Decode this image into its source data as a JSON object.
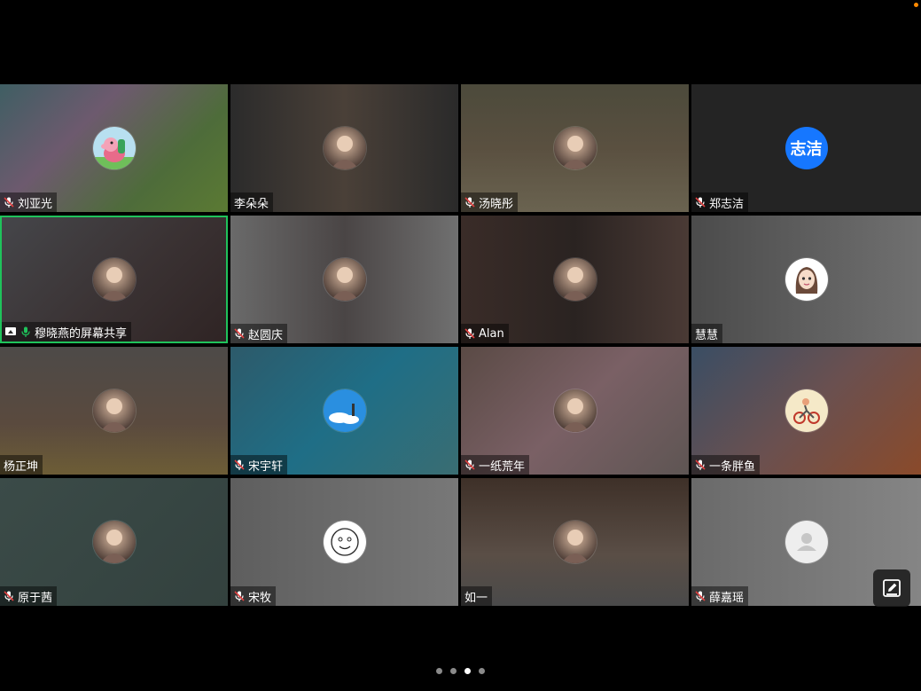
{
  "colors": {
    "active_border": "#1fc35b",
    "mic_on": "#1fc35b",
    "muted_icon": "#ffffff",
    "status_dot": "#ff8a00"
  },
  "participants": [
    {
      "name": "刘亚光",
      "mic": "muted",
      "avatar_icon": "peppa-pig-avatar",
      "bg": "linear-gradient(135deg,#3f5e63 0%,#6d5a6e 35%,#4e6c3a 70%,#5b7a33 100%)"
    },
    {
      "name": "李朵朵",
      "mic": "none",
      "avatar_icon": "photo-avatar",
      "bg": "linear-gradient(90deg,#2b2b2b 0%,#4a4038 50%,#2a2a2a 100%)"
    },
    {
      "name": "汤晓彤",
      "mic": "muted",
      "avatar_icon": "photo-avatar",
      "bg": "linear-gradient(180deg,#4c4a3b 0%,#5a5040 50%,#6a6350 100%)"
    },
    {
      "name": "郑志洁",
      "mic": "muted",
      "avatar_icon": "text-avatar",
      "avatar_text": "志洁",
      "bg": "#242424"
    },
    {
      "name": "穆晓燕的屏幕共享",
      "mic": "on",
      "screen_share": true,
      "active": true,
      "avatar_icon": "photo-avatar",
      "bg": "linear-gradient(135deg,#45464a 0%,#3a3233 55%,#2f2424 100%)"
    },
    {
      "name": "赵圆庆",
      "mic": "muted",
      "avatar_icon": "photo-avatar",
      "bg": "linear-gradient(90deg,#6a6a6a 0%,#4a4545 50%,#707070 100%)"
    },
    {
      "name": "Alan",
      "mic": "muted",
      "avatar_icon": "photo-avatar",
      "bg": "linear-gradient(90deg,#3a2c28 0%,#2a2321 50%,#4a3a35 100%)"
    },
    {
      "name": "慧慧",
      "mic": "none",
      "avatar_icon": "cartoon-girl-avatar",
      "bg": "linear-gradient(90deg,#4b4b4b 0%,#707070 100%)"
    },
    {
      "name": "杨正坤",
      "mic": "none",
      "avatar_icon": "photo-avatar",
      "bg": "linear-gradient(180deg,#4d4a48 0%,#5a4a3e 60%,#6d5d36 100%)"
    },
    {
      "name": "宋宇轩",
      "mic": "muted",
      "avatar_icon": "sky-avatar",
      "bg": "linear-gradient(135deg,#2d5a6a 0%,#1f6e86 50%,#3a6d72 100%)"
    },
    {
      "name": "一纸荒年",
      "mic": "muted",
      "avatar_icon": "photo-avatar",
      "bg": "linear-gradient(135deg,#5a4a45 0%,#7a6065 50%,#5e5553 100%)"
    },
    {
      "name": "一条胖鱼",
      "mic": "muted",
      "avatar_icon": "bicycle-avatar",
      "bg": "linear-gradient(135deg,#3a4e64 0%,#6a5050 50%,#8a4a2a 100%)"
    },
    {
      "name": "原于茜",
      "mic": "muted",
      "avatar_icon": "photo-avatar",
      "bg": "linear-gradient(135deg,#3b4b48 0%,#33413e 100%)"
    },
    {
      "name": "宋牧",
      "mic": "muted",
      "avatar_icon": "smiley-sketch-avatar",
      "bg": "linear-gradient(90deg,#5e5e5e 0%,#787878 100%)"
    },
    {
      "name": "如一",
      "mic": "none",
      "avatar_icon": "photo-avatar",
      "bg": "linear-gradient(180deg,#3e3028 0%,#5a4e46 60%,#4a4a4a 100%)"
    },
    {
      "name": "薛嘉瑶",
      "mic": "muted",
      "avatar_icon": "default-user-avatar",
      "bg": "linear-gradient(90deg,#6a6a6a 0%,#858585 100%)"
    }
  ],
  "pager": {
    "count": 4,
    "active_index": 2
  },
  "floating_button": {
    "icon": "annotate-pencil-icon"
  }
}
